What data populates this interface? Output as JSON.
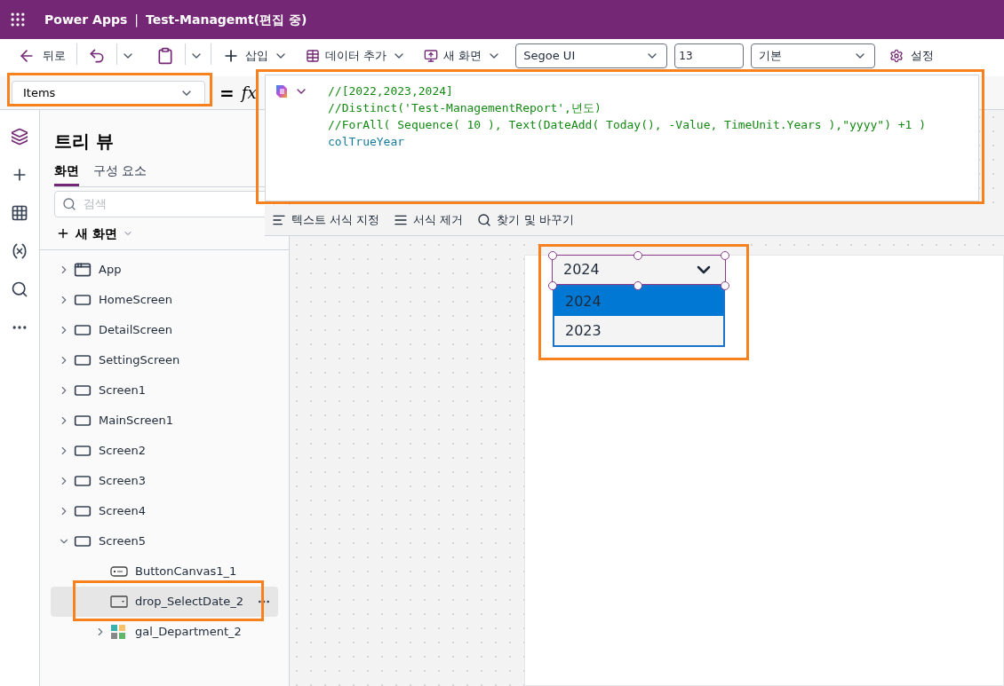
{
  "app_bar": {
    "product": "Power Apps",
    "separator": "|",
    "document": "Test-Managemt(편집 중)"
  },
  "toolbar": {
    "back": "뒤로",
    "insert": "삽입",
    "add_data": "데이터 추가",
    "new_screen": "새 화면",
    "font": "Segoe UI",
    "font_size": "13",
    "style": "기본",
    "settings": "설정"
  },
  "formula_bar": {
    "property": "Items",
    "equals": "=",
    "fx": "fx"
  },
  "formula_editor": {
    "lines": [
      {
        "kind": "comment",
        "text": "//[2022,2023,2024]"
      },
      {
        "kind": "comment",
        "text": "//Distinct('Test-ManagementReport',년도)"
      },
      {
        "kind": "comment",
        "text": "//ForAll( Sequence( 10 ), Text(DateAdd( Today(), -Value, TimeUnit.Years ),\"yyyy\") +1 )"
      },
      {
        "kind": "identifier",
        "text": "colTrueYear"
      }
    ],
    "tools": [
      "텍스트 서식 지정",
      "서식 제거",
      "찾기 및 바꾸기"
    ]
  },
  "tree_view": {
    "title": "트리 뷰",
    "tabs": [
      {
        "label": "화면",
        "selected": true
      },
      {
        "label": "구성 요소",
        "selected": false
      }
    ],
    "search": {
      "placeholder": "검색"
    },
    "new_screen": "새 화면",
    "items": [
      {
        "kind": "app",
        "label": "App",
        "expanded": false,
        "selected": false
      },
      {
        "kind": "screen",
        "label": "HomeScreen",
        "expanded": false,
        "selected": false
      },
      {
        "kind": "screen",
        "label": "DetailScreen",
        "expanded": false,
        "selected": false
      },
      {
        "kind": "screen",
        "label": "SettingScreen",
        "expanded": false,
        "selected": false
      },
      {
        "kind": "screen",
        "label": "Screen1",
        "expanded": false,
        "selected": false
      },
      {
        "kind": "screen",
        "label": "MainScreen1",
        "expanded": false,
        "selected": false
      },
      {
        "kind": "screen",
        "label": "Screen2",
        "expanded": false,
        "selected": false
      },
      {
        "kind": "screen",
        "label": "Screen3",
        "expanded": false,
        "selected": false
      },
      {
        "kind": "screen",
        "label": "Screen4",
        "expanded": false,
        "selected": false
      },
      {
        "kind": "screen",
        "label": "Screen5",
        "expanded": true,
        "selected": false,
        "children": [
          {
            "kind": "button",
            "label": "ButtonCanvas1_1",
            "selected": false
          },
          {
            "kind": "dropdown",
            "label": "drop_SelectDate_2",
            "selected": true
          },
          {
            "kind": "gallery",
            "label": "gal_Department_2",
            "expanded": false,
            "selected": false
          }
        ]
      }
    ]
  },
  "canvas": {
    "dropdown": {
      "value": "2024",
      "options": [
        {
          "label": "2024",
          "selected": true
        },
        {
          "label": "2023",
          "selected": false
        }
      ]
    }
  }
}
